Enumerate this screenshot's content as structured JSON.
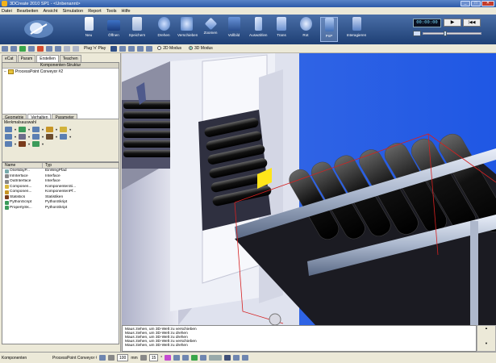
{
  "window": {
    "title": "3DCreate 2010 SP1 - <Unbenannt>"
  },
  "menu": [
    "Datei",
    "Bearbeiten",
    "Ansicht",
    "Simulation",
    "Report",
    "Tools",
    "Hilfe"
  ],
  "ribbon": {
    "buttons": [
      {
        "label": "Neu",
        "icon": "new-icon"
      },
      {
        "label": "Öffnen",
        "icon": "open-icon"
      },
      {
        "label": "Speichern",
        "icon": "save-icon"
      },
      {
        "label": "Drehen",
        "icon": "rotate-icon"
      },
      {
        "label": "Verschieben",
        "icon": "pan-icon"
      },
      {
        "label": "Zoomen",
        "icon": "zoom-icon"
      },
      {
        "label": "Vollbild",
        "icon": "fullscreen-icon"
      },
      {
        "label": "Auswählen",
        "icon": "select-icon"
      },
      {
        "label": "Trans",
        "icon": "translate-icon"
      },
      {
        "label": "Rot",
        "icon": "rotate-object-icon"
      },
      {
        "label": "PnP",
        "icon": "pnp-icon"
      },
      {
        "label": "Interagieren",
        "icon": "interact-icon"
      }
    ],
    "time": "00:00:00"
  },
  "toolbar2": {
    "plug_label": "Plug 'n' Play",
    "mode2d": "2D Modus",
    "mode3d": "3D Modus"
  },
  "left_top": {
    "tabs": [
      "eCat",
      "Param",
      "Erstellen",
      "Teachen"
    ],
    "active_tab": "Erstellen",
    "tree_header": "Komponenten-Struktur",
    "tree_node": "ProcessPoint Conveyor #2"
  },
  "left_bottom": {
    "tabs": [
      "Geometrie",
      "Verhalten",
      "Parameter"
    ],
    "active_tab": "Verhalten",
    "section_label": "Merkmalsauswahl",
    "columns": [
      "Name",
      "Typ"
    ],
    "rows": [
      {
        "name": "OneWayP...",
        "type": "EinWegPfad"
      },
      {
        "name": "InInterface",
        "type": "Interface"
      },
      {
        "name": "OutInterface",
        "type": "Interface"
      },
      {
        "name": "Componen...",
        "type": "KomponentenSi..."
      },
      {
        "name": "Componen...",
        "type": "KomponentenPf..."
      },
      {
        "name": "Statistics",
        "type": "Statistiken"
      },
      {
        "name": "PythonScript",
        "type": "PythonSkript"
      },
      {
        "name": "PropertySk...",
        "type": "PythonSkript"
      }
    ]
  },
  "output": {
    "lines": [
      "Maus ziehen, um 3D-Welt zu verschieben",
      "Maus ziehen, um 3D-Welt zu drehen",
      "Maus ziehen, um 3D-Welt zu drehen",
      "Maus ziehen, um 3D-Welt zu verschieben",
      "Maus ziehen, um 3D-Welt zu drehen"
    ]
  },
  "status": {
    "left_label": "Komponenten",
    "selected": "ProcessPoint Conveyor #2",
    "grid_value": "100",
    "grid_unit": "mm",
    "angle_value": "15",
    "angle_unit": "°"
  },
  "colors": {
    "ribbon_top": "#4a6fa8",
    "ribbon_bottom": "#1e3f74",
    "viewport_bg": "#1f5be0",
    "floor": "#f2f2f2",
    "selection_box": "#d62020"
  }
}
